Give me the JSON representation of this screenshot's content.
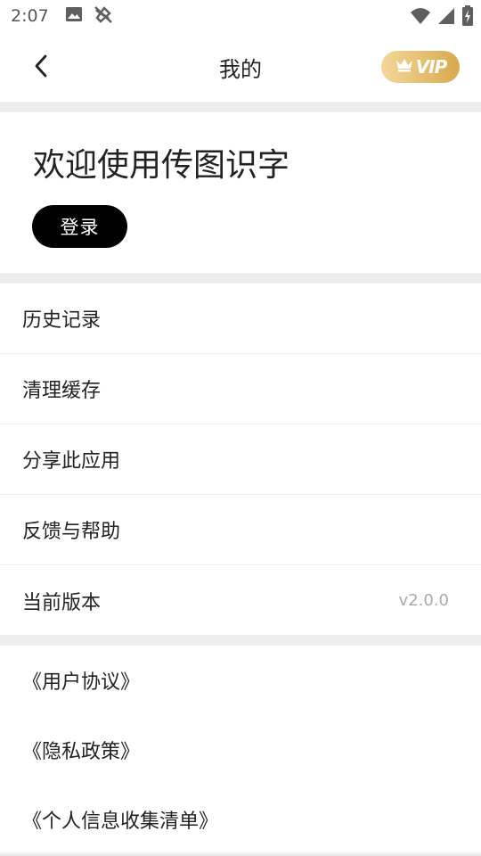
{
  "status_bar": {
    "time": "2:07",
    "left_icons": [
      "image-icon",
      "no-signal-tool-icon"
    ],
    "right_icons": [
      "wifi-icon",
      "cellular-signal-icon",
      "battery-charging-icon"
    ]
  },
  "header": {
    "title": "我的",
    "back_icon": "chevron-left-icon",
    "vip_label": "VIP",
    "vip_icon": "crown-icon",
    "vip_colors": [
      "#f3d79a",
      "#d9a94c"
    ]
  },
  "welcome": {
    "title": "欢迎使用传图识字",
    "login_label": "登录"
  },
  "menu": {
    "items": [
      {
        "label": "历史记录"
      },
      {
        "label": "清理缓存"
      },
      {
        "label": "分享此应用"
      },
      {
        "label": "反馈与帮助"
      },
      {
        "label": "当前版本",
        "value": "v2.0.0"
      }
    ]
  },
  "links": {
    "items": [
      {
        "label": "《用户协议》"
      },
      {
        "label": "《隐私政策》"
      },
      {
        "label": "《个人信息收集清单》"
      }
    ]
  }
}
